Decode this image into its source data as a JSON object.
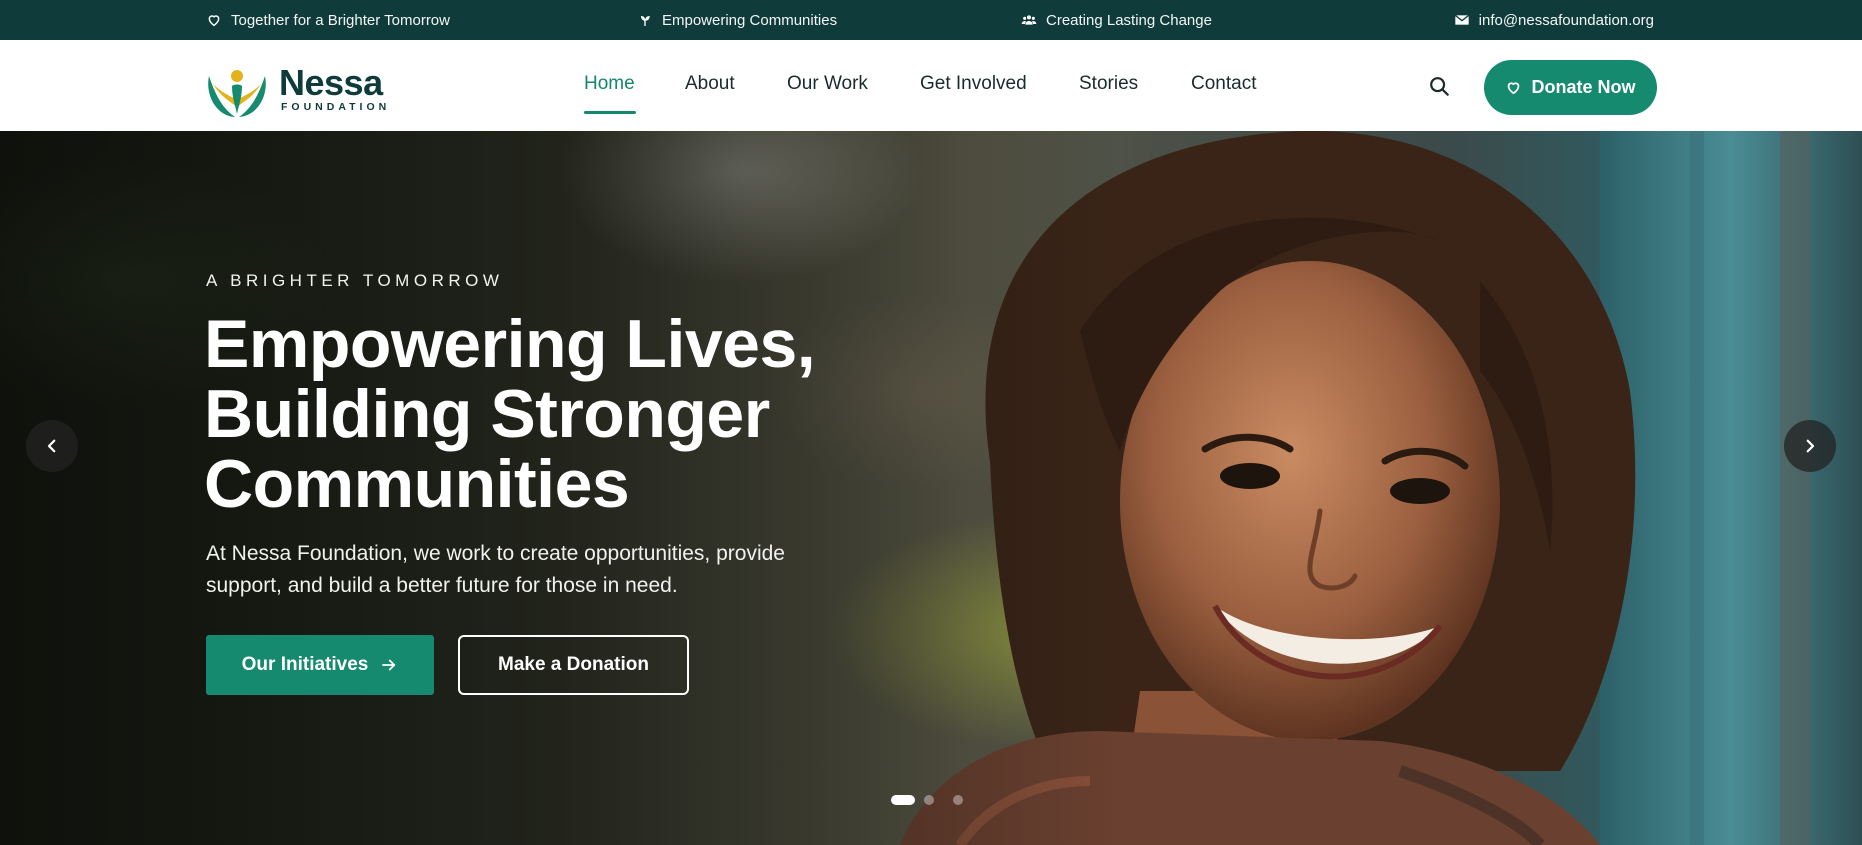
{
  "topbar": {
    "items": [
      {
        "icon": "heart-outline-icon",
        "text": "Together for a Brighter Tomorrow"
      },
      {
        "icon": "sprout-icon",
        "text": "Empowering Communities"
      },
      {
        "icon": "people-icon",
        "text": "Creating Lasting Change"
      },
      {
        "icon": "envelope-icon",
        "text": "info@nessafoundation.org"
      }
    ]
  },
  "header": {
    "logo": {
      "name": "Nessa",
      "subtitle": "FOUNDATION"
    },
    "nav": [
      {
        "label": "Home",
        "active": true
      },
      {
        "label": "About"
      },
      {
        "label": "Our Work"
      },
      {
        "label": "Get Involved"
      },
      {
        "label": "Stories"
      },
      {
        "label": "Contact"
      }
    ],
    "search_icon": "search-icon",
    "donate_label": "Donate Now"
  },
  "hero": {
    "eyebrow": "A BRIGHTER TOMORROW",
    "headline": "Empowering Lives, Building Stronger Communities",
    "subtext": "At Nessa Foundation, we work to create opportunities, provide support, and build a better future for those in need.",
    "primary_cta": "Our Initiatives",
    "secondary_cta": "Make a Donation",
    "carousel": {
      "slides": 3,
      "active_slide": 1
    }
  },
  "colors": {
    "topbar_bg": "#0f3b3a",
    "brand_green": "#158a6f",
    "logo_dark": "#0f3b3a",
    "logo_yellow": "#e3b21c",
    "text_dark": "#1b2b2a"
  }
}
